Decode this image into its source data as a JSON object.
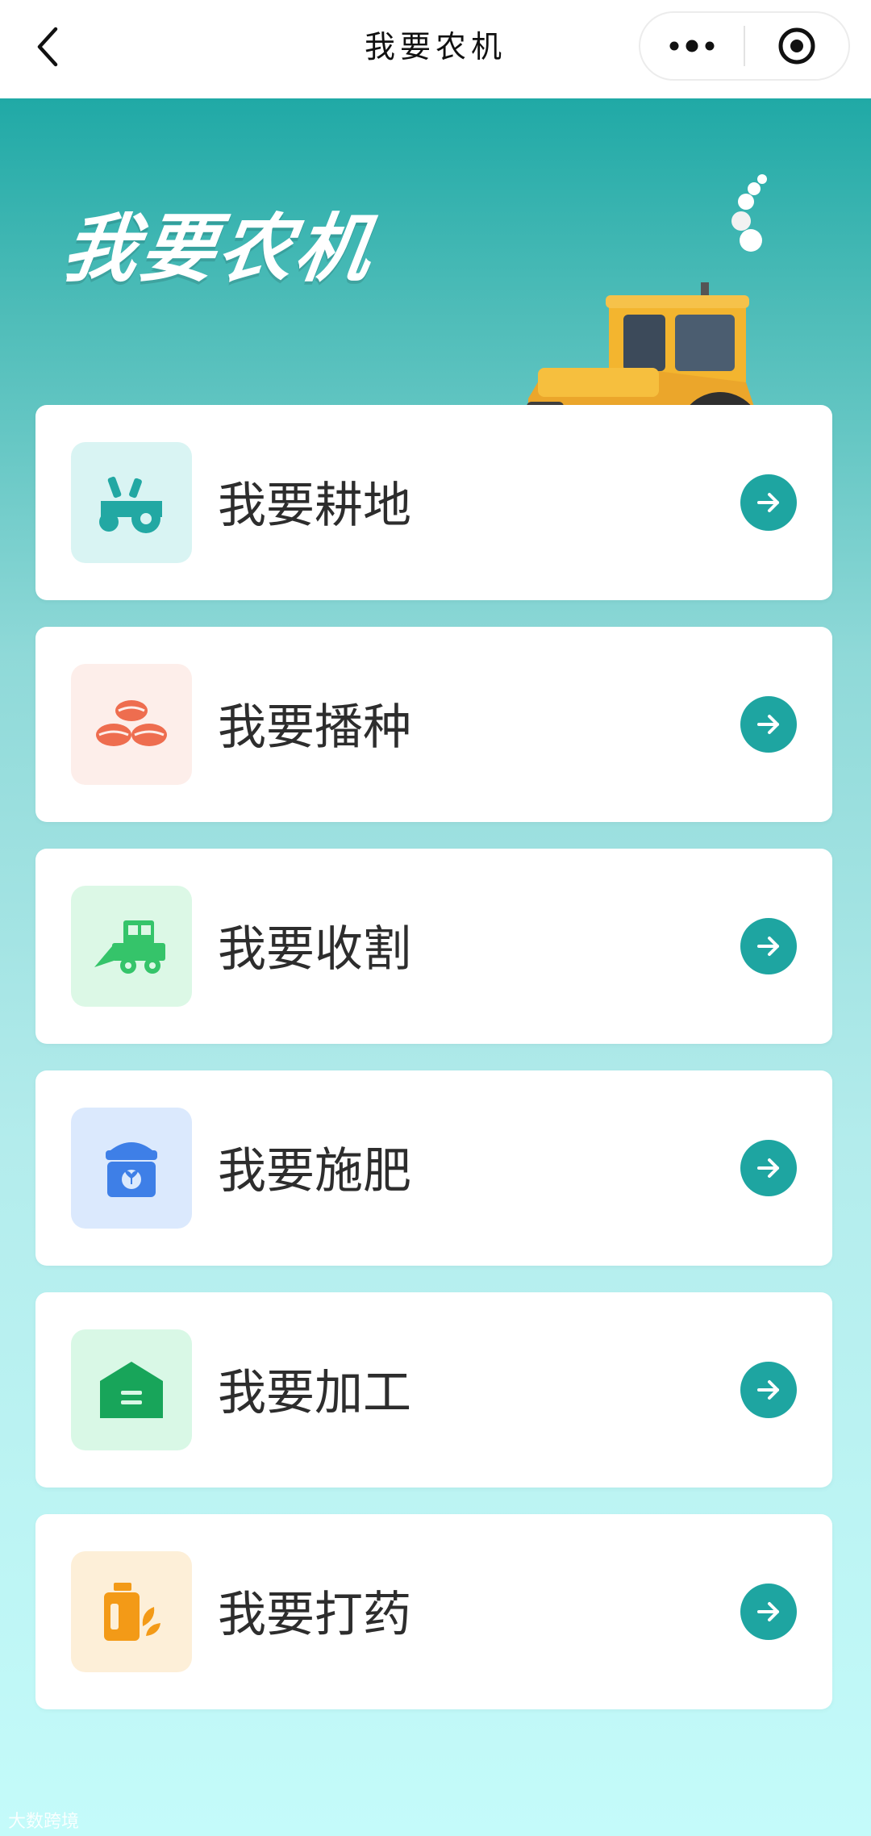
{
  "nav": {
    "title": "我要农机"
  },
  "hero": {
    "title": "我要农机"
  },
  "menu": [
    {
      "label": "我要耕地",
      "icon": "tractor-icon",
      "icon_bg": "#d9f4f3",
      "icon_color": "#22a8a3"
    },
    {
      "label": "我要播种",
      "icon": "seeds-icon",
      "icon_bg": "#fdeeea",
      "icon_color": "#ee6d4f"
    },
    {
      "label": "我要收割",
      "icon": "harvester-icon",
      "icon_bg": "#dcf8e6",
      "icon_color": "#35c46a"
    },
    {
      "label": "我要施肥",
      "icon": "fertilizer-bag-icon",
      "icon_bg": "#dbe9fd",
      "icon_color": "#3e7fe7"
    },
    {
      "label": "我要加工",
      "icon": "warehouse-icon",
      "icon_bg": "#d9f8e6",
      "icon_color": "#18a55a"
    },
    {
      "label": "我要打药",
      "icon": "pesticide-icon",
      "icon_bg": "#fdefd8",
      "icon_color": "#f39a17"
    }
  ],
  "colors": {
    "accent": "#1ea5a1"
  },
  "watermark": "大数跨境"
}
